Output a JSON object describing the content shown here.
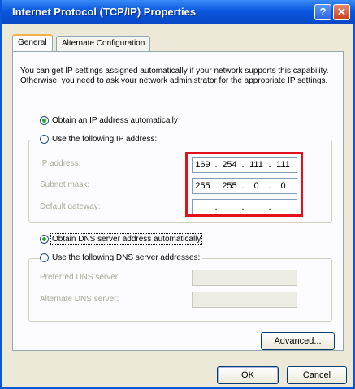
{
  "window": {
    "title": "Internet Protocol (TCP/IP) Properties",
    "help_label": "?",
    "close_label": "✕"
  },
  "tabs": [
    {
      "label": "General",
      "active": true
    },
    {
      "label": "Alternate Configuration",
      "active": false
    }
  ],
  "intro_text": "You can get IP settings assigned automatically if your network supports this capability. Otherwise, you need to ask your network administrator for the appropriate IP settings.",
  "ip_section": {
    "obtain_auto_label": "Obtain an IP address automatically",
    "use_following_label": "Use the following IP address:",
    "selected": "obtain_auto",
    "fields": [
      {
        "label": "IP address:",
        "octets": [
          "169",
          "254",
          "111",
          "111"
        ]
      },
      {
        "label": "Subnet mask:",
        "octets": [
          "255",
          "255",
          "0",
          "0"
        ]
      },
      {
        "label": "Default gateway:",
        "octets": [
          "",
          "",
          "",
          ""
        ]
      }
    ]
  },
  "dns_section": {
    "obtain_auto_label": "Obtain DNS server address automatically",
    "use_following_label": "Use the following DNS server addresses:",
    "selected": "obtain_auto",
    "fields": [
      {
        "label": "Preferred DNS server:"
      },
      {
        "label": "Alternate DNS server:"
      }
    ]
  },
  "buttons": {
    "advanced": "Advanced...",
    "ok": "OK",
    "cancel": "Cancel"
  },
  "colors": {
    "title_bar": "#0a56df",
    "highlight_box": "#e0131c",
    "dialog_bg": "#ece9d8"
  },
  "dot_separator": "."
}
